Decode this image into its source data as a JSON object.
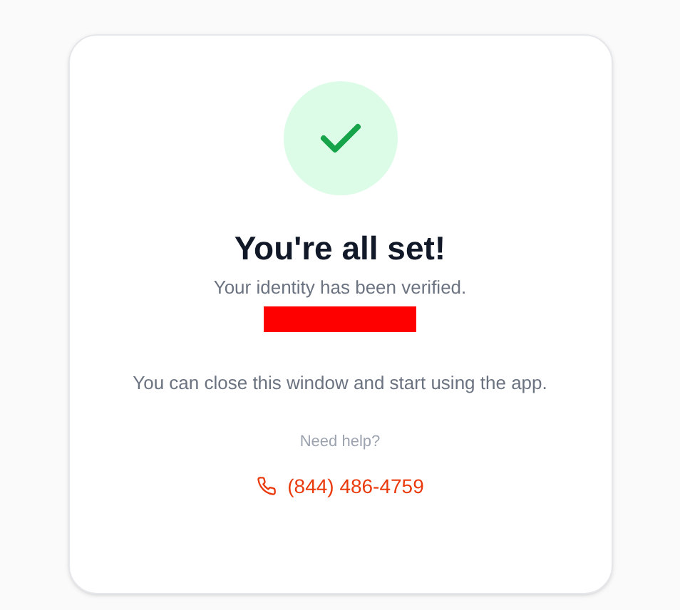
{
  "card": {
    "title": "You're all set!",
    "subtitle": "Your identity has been verified.",
    "message": "You can close this window and start using the app.",
    "help_label": "Need help?",
    "phone": "(844) 486-4759"
  }
}
